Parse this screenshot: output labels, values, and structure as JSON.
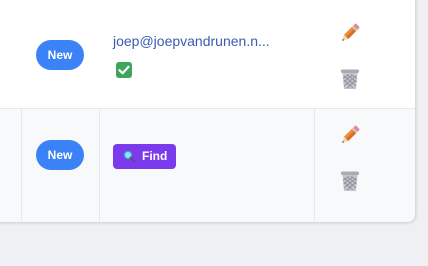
{
  "rows": [
    {
      "status_badge": "New",
      "email": "joep@joepvandrunen.n...",
      "verified_icon": "check-box-icon",
      "actions": [
        "pencil-icon",
        "wastebasket-icon"
      ]
    },
    {
      "status_badge": "New",
      "find_button": "Find",
      "find_icon": "magnifier-icon",
      "actions": [
        "pencil-icon",
        "wastebasket-icon"
      ]
    }
  ],
  "colors": {
    "badge": "#3b82f6",
    "find_button": "#7c3aed",
    "email_link": "#3a5bb0",
    "verified": "#3ea55d"
  }
}
